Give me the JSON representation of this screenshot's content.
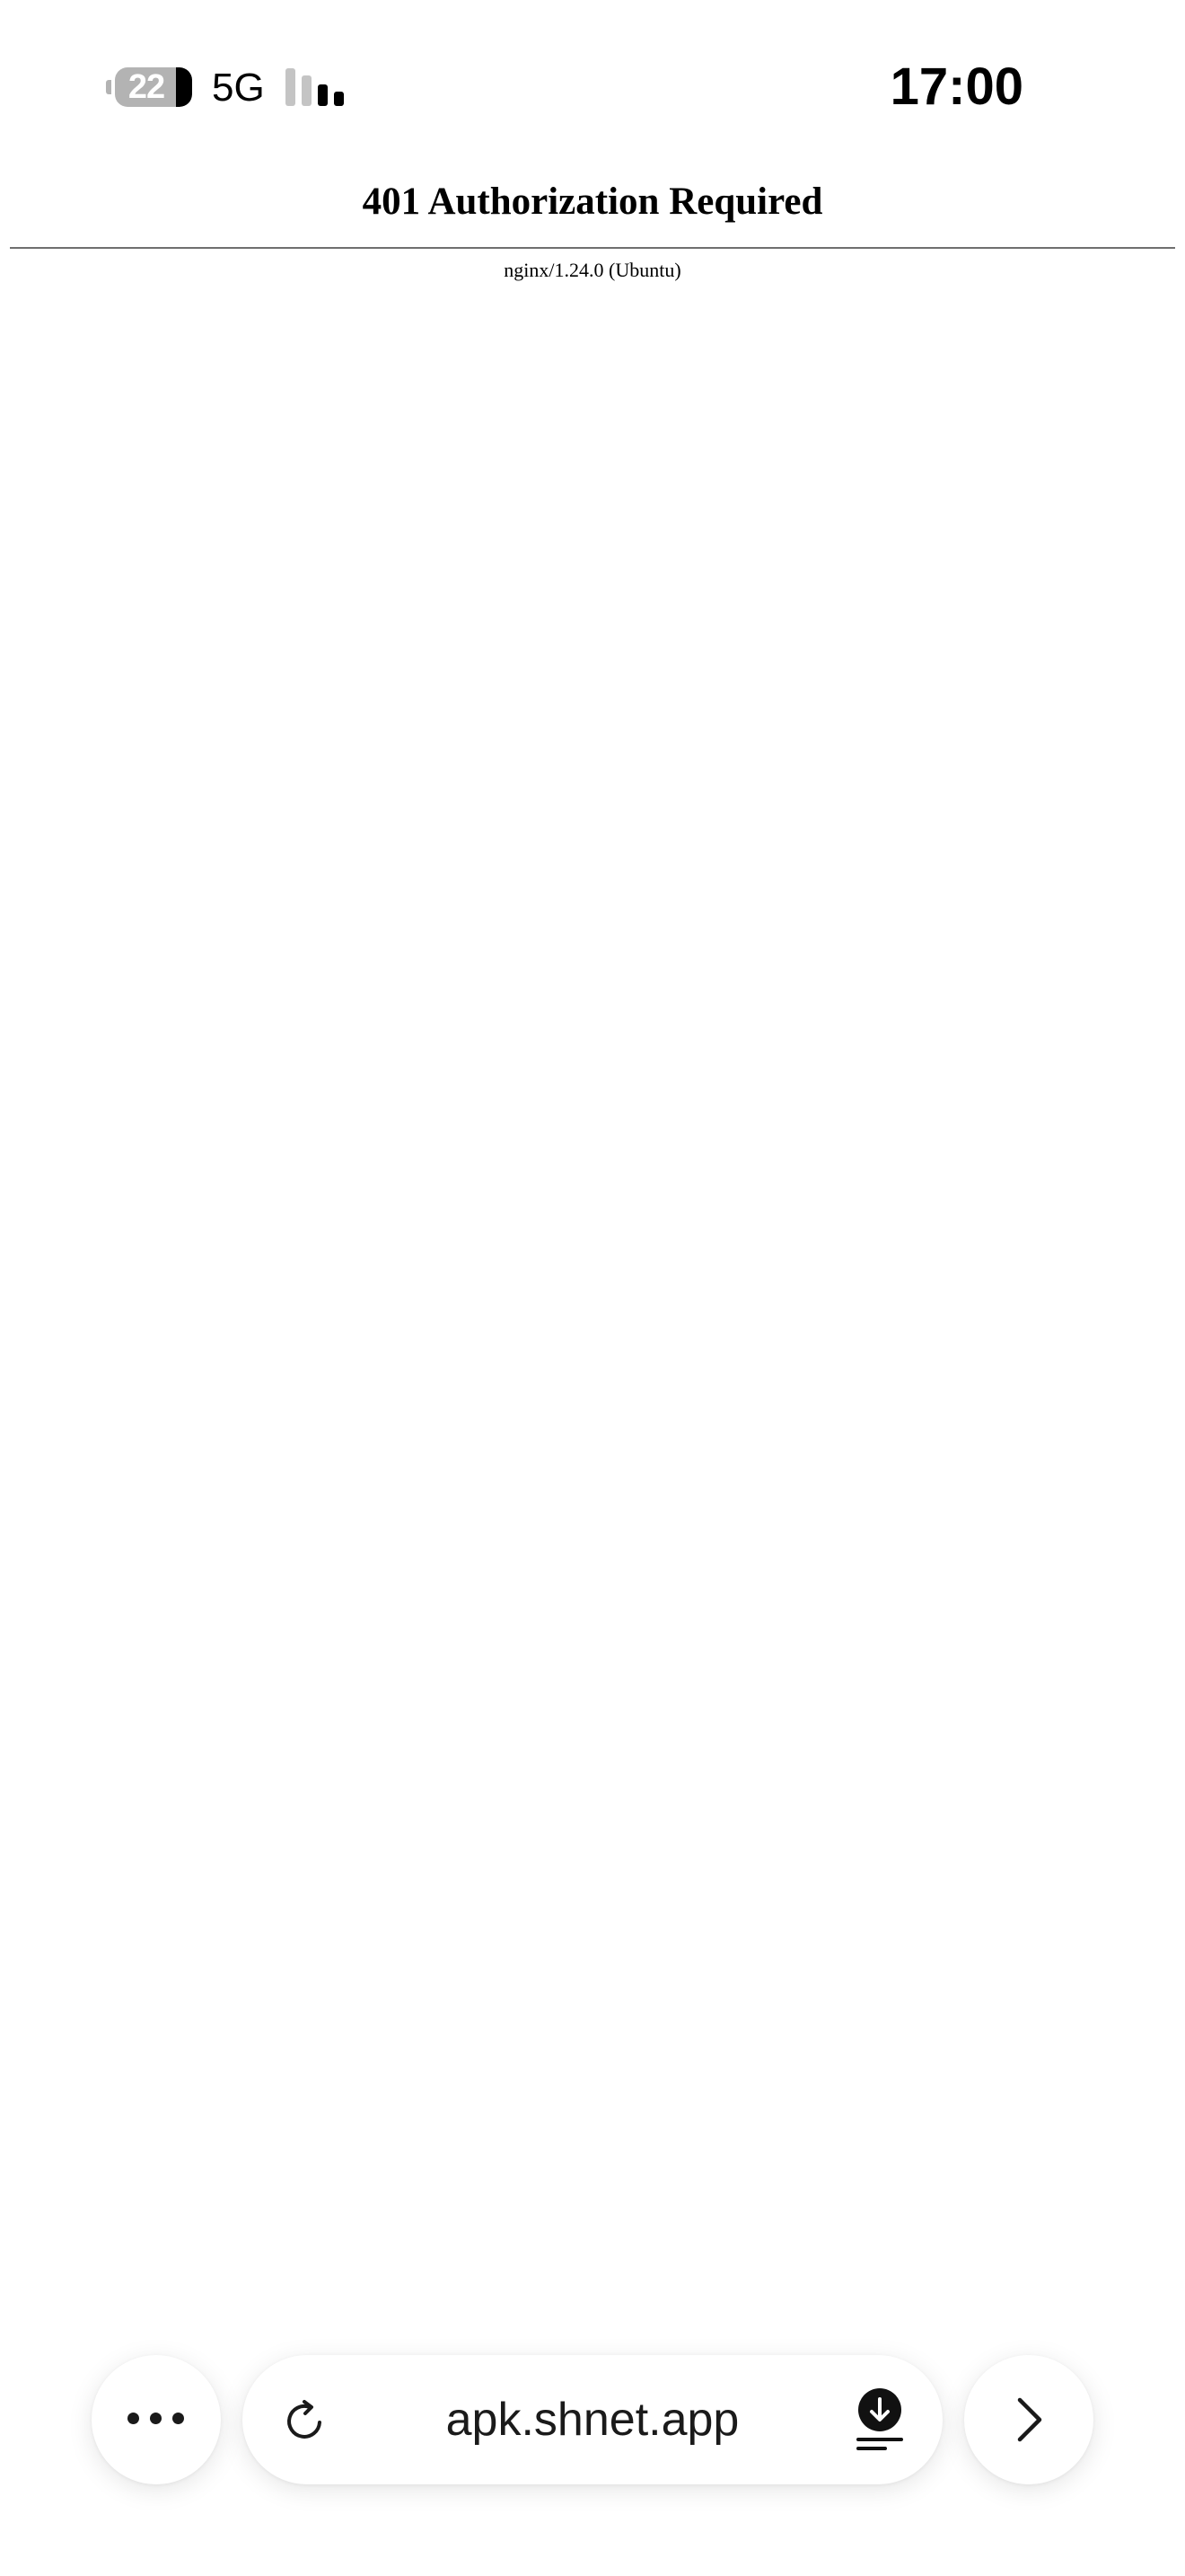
{
  "status_bar": {
    "battery_level": "22",
    "network": "5G",
    "time": "17:00",
    "signal_bars_active": 2,
    "signal_bars_total": 4
  },
  "page": {
    "title": "401 Authorization Required",
    "server": "nginx/1.24.0 (Ubuntu)"
  },
  "browser_bar": {
    "url": "apk.shnet.app",
    "more_icon": "more-horizontal-icon",
    "reload_icon": "reload-icon",
    "download_icon": "download-icon",
    "forward_icon": "chevron-right-icon"
  },
  "colors": {
    "background": "#ffffff",
    "text": "#000000",
    "divider": "#6f6f6f",
    "battery_gray": "#b3b3b3"
  }
}
